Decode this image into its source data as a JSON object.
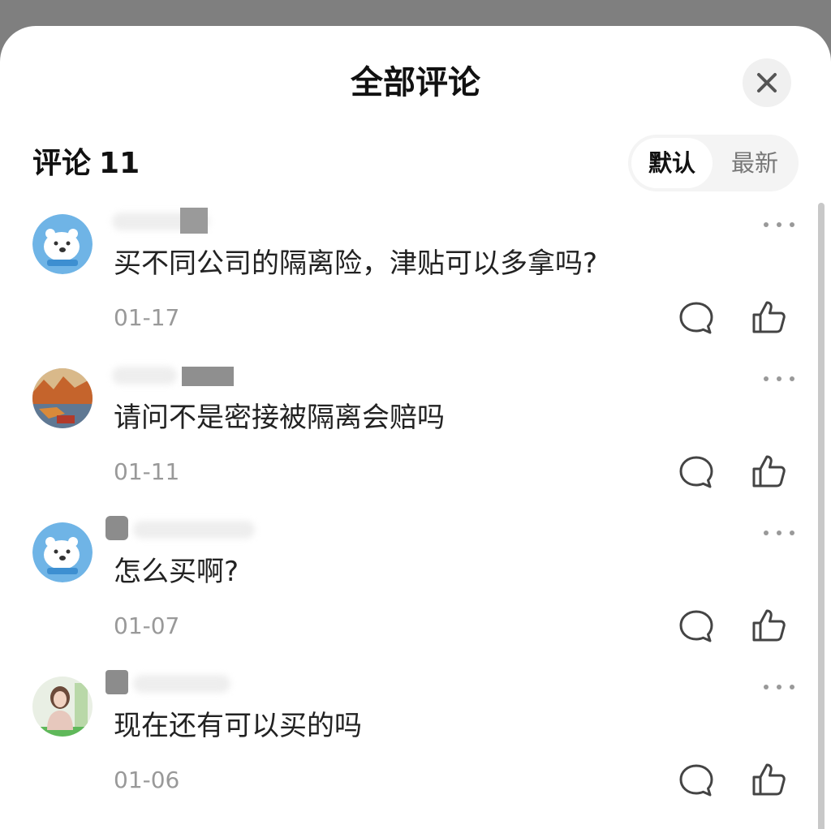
{
  "header": {
    "title": "全部评论",
    "close_icon": "close-icon"
  },
  "comments_section": {
    "label": "评论",
    "count": "11",
    "sort_options": [
      "默认",
      "最新"
    ],
    "active_sort": "默认"
  },
  "comments": [
    {
      "avatar": "polar-bear-avatar",
      "text": "买不同公司的隔离险，津贴可以多拿吗?",
      "date": "01-17"
    },
    {
      "avatar": "landscape-photo-avatar",
      "text": "请问不是密接被隔离会赔吗",
      "date": "01-11"
    },
    {
      "avatar": "polar-bear-avatar",
      "text": "怎么买啊?",
      "date": "01-07"
    },
    {
      "avatar": "person-photo-avatar",
      "text": "现在还有可以买的吗",
      "date": "01-06"
    }
  ],
  "icons": {
    "more": "more-dots-icon",
    "reply": "chat-bubble-icon",
    "like": "thumbs-up-icon"
  },
  "colors": {
    "backdrop": "#7f7f7f",
    "sheet": "#ffffff",
    "primary_text": "#222222",
    "secondary_text": "#999999"
  }
}
